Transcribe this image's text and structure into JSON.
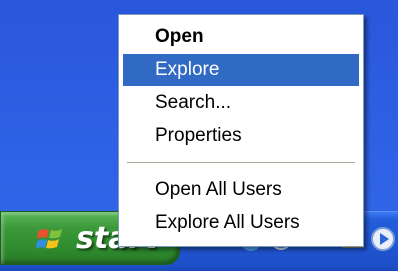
{
  "context_menu": {
    "items": [
      {
        "label": "Open",
        "bold": true,
        "highlighted": false
      },
      {
        "label": "Explore",
        "bold": false,
        "highlighted": true
      },
      {
        "label": "Search...",
        "bold": false,
        "highlighted": false
      },
      {
        "label": "Properties",
        "bold": false,
        "highlighted": false
      },
      {
        "label": "Open All Users",
        "bold": false,
        "highlighted": false
      },
      {
        "label": "Explore All Users",
        "bold": false,
        "highlighted": false
      }
    ]
  },
  "taskbar": {
    "start_label": "start",
    "quicklaunch_icons": [
      "internet-explorer-icon",
      "media-player-icon",
      "mail-icon",
      "desktop-icon"
    ]
  },
  "colors": {
    "desktop": "#2d5fe0",
    "highlight": "#316ac5",
    "start_green": "#3c9a3a"
  }
}
